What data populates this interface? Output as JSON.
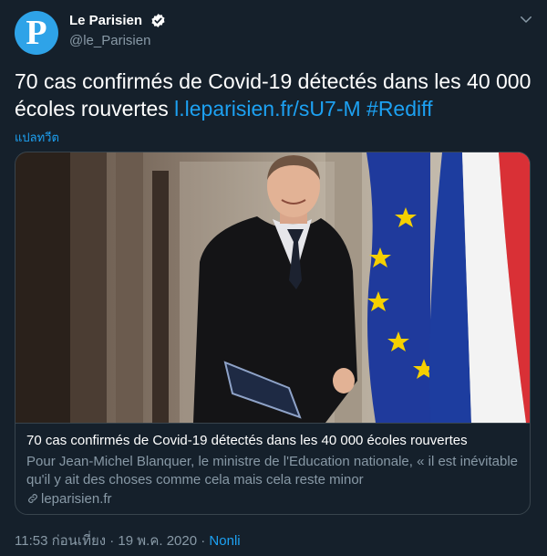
{
  "author": {
    "avatar_letter": "P",
    "display_name": "Le Parisien",
    "handle": "@le_Parisien",
    "avatar_color": "#2ea3e8"
  },
  "icons": [
    "verified-icon",
    "chevron-down-icon",
    "link-icon"
  ],
  "tweet": {
    "text": "70 cas confirmés de Covid-19 détectés dans les 40 000 écoles rouvertes",
    "link": "l.leparisien.fr/sU7-M",
    "hashtag": "#Rediff",
    "translate_label": "แปลทวีต"
  },
  "card": {
    "title": "70 cas confirmés de Covid-19 détectés dans les 40 000 écoles rouvertes",
    "description": "Pour Jean-Michel Blanquer, le ministre de l'Education nationale, « il est inévitable qu'il y ait des choses comme cela mais cela reste minor",
    "domain": "leparisien.fr"
  },
  "meta": {
    "time": "11:53 ก่อนเที่ยง",
    "sep1": " · ",
    "date": "19 พ.ค. 2020",
    "sep2": " · ",
    "source": "Nonli"
  },
  "colors": {
    "background": "#15202b",
    "accent": "#1da1f2",
    "secondary_text": "#8899a6",
    "border": "#38444d"
  }
}
